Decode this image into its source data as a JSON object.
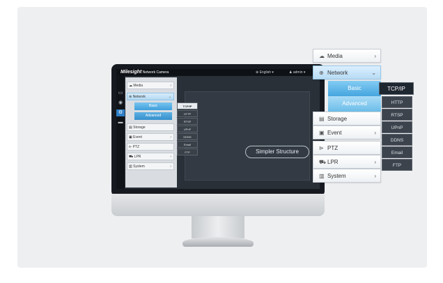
{
  "app": {
    "brand_prefix": "Milesight",
    "brand_suffix": "Network Camera",
    "language": "⊕ English ▾",
    "user": "♟ admin ▾"
  },
  "rail_icons": [
    "monitor-icon",
    "playback-icon",
    "settings-icon",
    "folder-icon"
  ],
  "screen_menu": {
    "media": "Media",
    "network": "Network",
    "basic": "Basic",
    "advanced": "Advanced",
    "storage": "Storage",
    "event": "Event",
    "ptz": "PTZ",
    "lpr": "LPR",
    "system": "System"
  },
  "screen_protocols": [
    "TCP/IP",
    "HTTP",
    "RTSP",
    "UPnP",
    "DDNS",
    "Email",
    "FTP"
  ],
  "callout": "Simpler Structure",
  "zoom_menu": {
    "media": "Media",
    "network": "Network",
    "basic": "Basic",
    "advanced": "Advanced",
    "storage": "Storage",
    "event": "Event",
    "ptz": "PTZ",
    "lpr": "LPR",
    "system": "System"
  },
  "zoom_protocols": [
    "TCP/IP",
    "HTTP",
    "RTSP",
    "UPnP",
    "DDNS",
    "Email",
    "FTP"
  ],
  "icons": {
    "media": "☁",
    "network": "⊕",
    "storage": "▤",
    "event": "▣",
    "ptz": "⊳",
    "lpr": "⛟",
    "system": "▥"
  }
}
